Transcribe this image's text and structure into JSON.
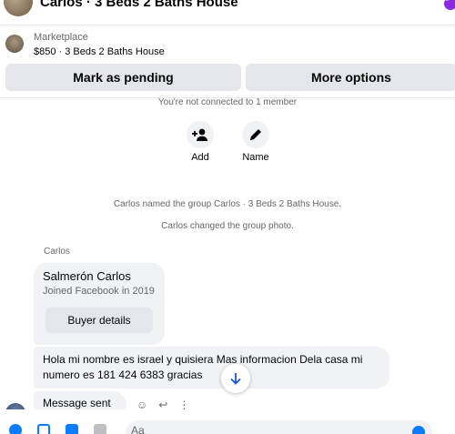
{
  "header": {
    "title": "Carlos · 3 Beds 2 Baths House"
  },
  "listing": {
    "label": "Marketplace",
    "price_title": "$850 · 3 Beds 2 Baths House",
    "pending_button": "Mark as pending",
    "more_button": "More options"
  },
  "thread": {
    "not_connected": "You're not connected to 1 member",
    "actions": [
      {
        "label": "Add",
        "icon": "add-person-icon"
      },
      {
        "label": "Name",
        "icon": "pencil-icon"
      }
    ],
    "system_1": "Carlos named the group Carlos · 3 Beds 2 Baths House.",
    "system_2": "Carlos changed the group photo.",
    "sender": "Carlos",
    "profile": {
      "name": "Salmerón Carlos",
      "joined": "Joined Facebook in 2019",
      "button": "Buyer details"
    },
    "message": "Hola mi nombre es israel y quisiera Mas informacion Dela casa mi numero es 181 424 6383 gracias",
    "sent": "Message sent"
  },
  "composer": {
    "placeholder": "Aa"
  },
  "colors": {
    "accent": "#0a7cff",
    "bubble": "#f0f2f5",
    "button": "#e4e6eb",
    "muted": "#65676b"
  }
}
